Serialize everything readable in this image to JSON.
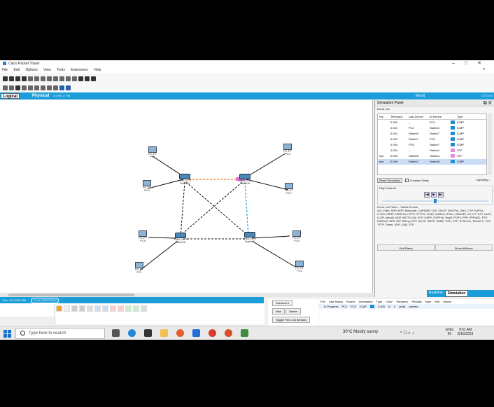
{
  "window": {
    "title": "Cisco Packet Tracer"
  },
  "menu": [
    "File",
    "Edit",
    "Options",
    "View",
    "Tools",
    "Extensions",
    "Help"
  ],
  "menu_help_icon": "?",
  "workspace": {
    "logical_tab": "Logical",
    "physical_tab": "Physical",
    "coords": "x:1796, y:798",
    "root": "[Root]",
    "clock": "07:37:00"
  },
  "devices": {
    "pc0": {
      "model": "PC-PT",
      "name": "PC0"
    },
    "pc1": {
      "model": "PC-PT",
      "name": "PC1"
    },
    "pc2": {
      "model": "PC-PT",
      "name": "PC2"
    },
    "pc3": {
      "model": "PC-PT",
      "name": "PC3"
    },
    "pc4": {
      "model": "PC-PT",
      "name": "PC4"
    },
    "pc5": {
      "model": "PC-PT",
      "name": "PC5"
    },
    "pc6": {
      "model": "PC-PT",
      "name": "PC6"
    },
    "pc7": {
      "model": "PC-PT",
      "name": "PC7"
    },
    "sw4": {
      "model": "2960-24TT",
      "name": "Switch4"
    },
    "sw5": {
      "model": "2960-24TT",
      "name": "Switch5"
    },
    "sw6": {
      "model": "2960-24TT",
      "name": "Switch6"
    },
    "sw7": {
      "model": "2960-24TT",
      "name": "Switch7"
    }
  },
  "sim_panel": {
    "title": "Simulation Panel",
    "event_list_label": "Event List",
    "headers": [
      "Vis.",
      "Time(sec)",
      "Last Device",
      "At Device",
      "Type"
    ],
    "events": [
      {
        "vis": "",
        "time": "0.000",
        "last": "--",
        "at": "PC2",
        "type": "ICMP",
        "color": "#1a8fd6"
      },
      {
        "vis": "",
        "time": "0.001",
        "last": "PC2",
        "at": "Switch4",
        "type": "ICMP",
        "color": "#1a8fd6"
      },
      {
        "vis": "",
        "time": "0.002",
        "last": "Switch5",
        "at": "Switch7",
        "type": "ICMP",
        "color": "#1a8fd6"
      },
      {
        "vis": "",
        "time": "0.003",
        "last": "Switch7",
        "at": "PC6",
        "type": "ICMP",
        "color": "#1a8fd6"
      },
      {
        "vis": "",
        "time": "0.004",
        "last": "PC6",
        "at": "Switch7",
        "type": "ICMP",
        "color": "#1a8fd6"
      },
      {
        "vis": "",
        "time": "0.004",
        "last": "--",
        "at": "Switch4",
        "type": "STP",
        "color": "#e88be0"
      },
      {
        "vis": "eye",
        "time": "0.005",
        "last": "Switch5",
        "at": "Switch4",
        "type": "STP",
        "color": "#e88be0"
      },
      {
        "vis": "eye",
        "time": "0.006",
        "last": "Switch7",
        "at": "Switch6",
        "type": "ICMP",
        "color": "#1a8fd6"
      }
    ],
    "reset_button": "Reset Simulation",
    "constant_delay": "Constant Delay",
    "capturing": "Capturing ...",
    "play_controls": "Play Controls",
    "filters_title": "Event List Filters - Visible Events",
    "filters_text": "ACL Filter, ARP, BGP, Bluetooth, CAPWAP, CDP, DHCP, DHCPv6, DNS, DTP, EAPOL, H.323, HSRP, HSRPv6, HTTP, HTTPS, ICMP, ICMPv6, IPSec, ISAKMP, IoT, IoT TCP, LACP, LLDP, Meraki, NDP, NETFLOW, NTP, OSPF, OSPFv6, PAgP, POP3, PPP, PPPoED, PTP, RADIUS, REP, RIP, RIPng, RTP, SCCP, SMTP, SNMP, SSH, STP, SYSLOG, TACACS, TCP, TFTP, Telnet, UDP, USB, VTP",
    "edit_filters": "Edit Filters",
    "show_all": "Show All/None"
  },
  "bottom": {
    "time": "Time: 00:13:38.256",
    "play_controls": "PLAY CONTROLS",
    "conn_caption": "Copper Straight-Through",
    "scenario": "Scenario 0",
    "new_btn": "New",
    "delete_btn": "Delete",
    "toggle_btn": "Toggle PDU List Window",
    "realtime_tab": "Realtime",
    "simulation_tab": "Simulation",
    "event_list_btn": "Event List",
    "pdu_headers": [
      "Fire",
      "Last Status",
      "Source",
      "Destination",
      "Type",
      "Color",
      "Time(sec)",
      "Periodic",
      "Num",
      "Edit",
      "Delete"
    ],
    "pdu_row": [
      "",
      "In Progress",
      "PC2",
      "PC6",
      "ICMP",
      "",
      "0.000",
      "N",
      "0",
      "(edit)",
      "(delete)"
    ]
  },
  "taskbar": {
    "search_placeholder": "Type here to search",
    "weather": "30°C  Mostly sunny",
    "lang_top": "ENG",
    "lang_bottom": "IN",
    "time": "9:51 AM",
    "date": "8/16/2023"
  }
}
